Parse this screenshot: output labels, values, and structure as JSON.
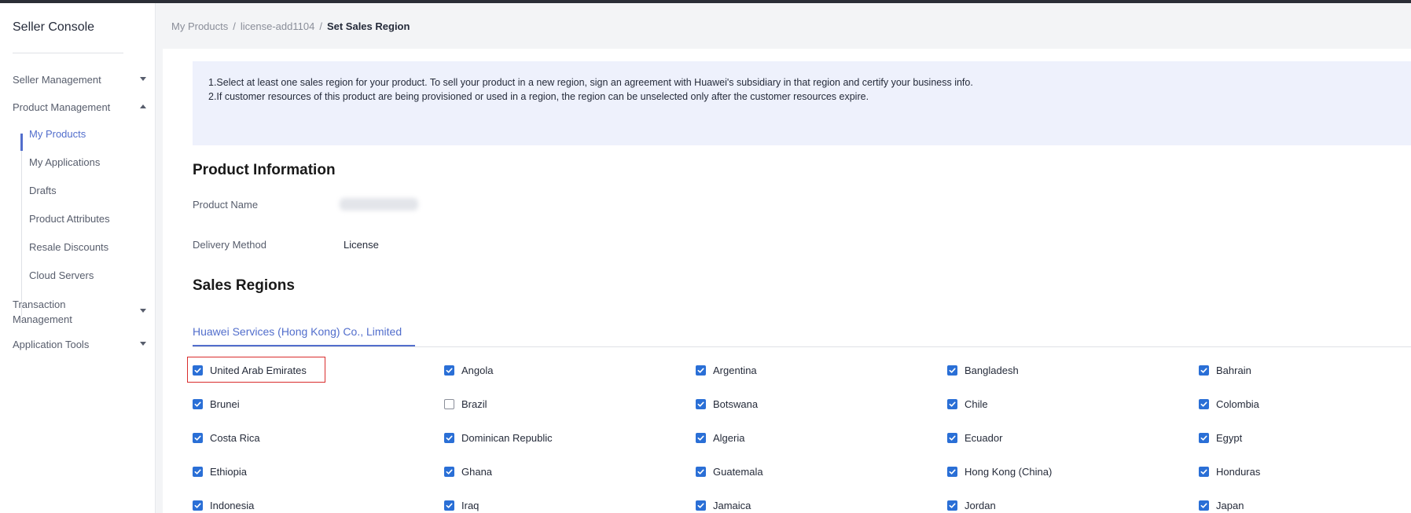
{
  "sidebar": {
    "title": "Seller Console",
    "groups": [
      {
        "label": "Seller Management"
      },
      {
        "label": "Product Management"
      },
      {
        "label": "Transaction Management"
      },
      {
        "label": "Application Tools"
      }
    ],
    "items": [
      {
        "label": "My Products"
      },
      {
        "label": "My Applications"
      },
      {
        "label": "Drafts"
      },
      {
        "label": "Product Attributes"
      },
      {
        "label": "Resale Discounts"
      },
      {
        "label": "Cloud Servers"
      }
    ]
  },
  "breadcrumb": {
    "items": [
      "My Products",
      "license-add1104"
    ],
    "current": "Set Sales Region"
  },
  "notice": {
    "line1": "1.Select at least one sales region for your product. To sell your product in a new region, sign an agreement with Huawei's subsidiary in that region and certify your business info.",
    "line2": "2.If customer resources of this product are being provisioned or used in a region, the region can be unselected only after the customer resources expire."
  },
  "product_info": {
    "title": "Product Information",
    "name_label": "Product Name",
    "delivery_label": "Delivery Method",
    "delivery_value": "License"
  },
  "sales_regions": {
    "title": "Sales Regions",
    "tab": "Huawei Services (Hong Kong) Co., Limited",
    "regions": [
      {
        "name": "United Arab Emirates",
        "checked": true
      },
      {
        "name": "Angola",
        "checked": true
      },
      {
        "name": "Argentina",
        "checked": true
      },
      {
        "name": "Bangladesh",
        "checked": true
      },
      {
        "name": "Bahrain",
        "checked": true
      },
      {
        "name": "Brunei",
        "checked": true
      },
      {
        "name": "Brazil",
        "checked": false
      },
      {
        "name": "Botswana",
        "checked": true
      },
      {
        "name": "Chile",
        "checked": true
      },
      {
        "name": "Colombia",
        "checked": true
      },
      {
        "name": "Costa Rica",
        "checked": true
      },
      {
        "name": "Dominican Republic",
        "checked": true
      },
      {
        "name": "Algeria",
        "checked": true
      },
      {
        "name": "Ecuador",
        "checked": true
      },
      {
        "name": "Egypt",
        "checked": true
      },
      {
        "name": "Ethiopia",
        "checked": true
      },
      {
        "name": "Ghana",
        "checked": true
      },
      {
        "name": "Guatemala",
        "checked": true
      },
      {
        "name": "Hong Kong (China)",
        "checked": true
      },
      {
        "name": "Honduras",
        "checked": true
      },
      {
        "name": "Indonesia",
        "checked": true
      },
      {
        "name": "Iraq",
        "checked": true
      },
      {
        "name": "Jamaica",
        "checked": true
      },
      {
        "name": "Jordan",
        "checked": true
      },
      {
        "name": "Japan",
        "checked": true
      }
    ]
  },
  "colors": {
    "accent": "#526ecc",
    "checkbox": "#2a6fd6",
    "highlight": "#d92d2d",
    "notice_bg": "#eef1fc"
  }
}
